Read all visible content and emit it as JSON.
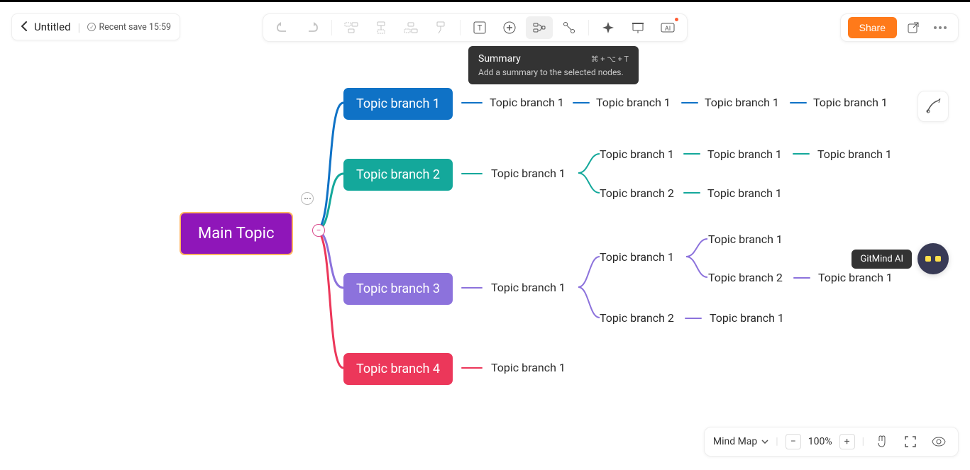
{
  "header": {
    "title": "Untitled",
    "recent_save": "Recent save 15:59"
  },
  "toolbar": {
    "tooltip": {
      "title": "Summary",
      "shortcut": "⌘ + ⌥ + T",
      "desc": "Add a summary to the selected nodes."
    }
  },
  "share_label": "Share",
  "ai_float_label": "GitMind AI",
  "mindmap": {
    "root": "Main Topic",
    "branches": [
      {
        "label": "Topic branch 1",
        "color": "#0f72c6",
        "children": [
          "Topic branch 1",
          "Topic branch 1",
          "Topic branch 1",
          "Topic branch 1"
        ]
      },
      {
        "label": "Topic branch 2",
        "color": "#14a89b",
        "children": [
          {
            "label": "Topic branch 1",
            "children": [
              {
                "label": "Topic branch 1",
                "children": [
                  "Topic branch 1",
                  "Topic branch 1"
                ]
              },
              {
                "label": "Topic branch 2",
                "children": [
                  "Topic branch 1"
                ]
              }
            ]
          }
        ]
      },
      {
        "label": "Topic branch 3",
        "color": "#8c72dc",
        "children": [
          {
            "label": "Topic branch 1",
            "children": [
              {
                "label": "Topic branch 1",
                "children": [
                  "Topic branch 1",
                  {
                    "label": "Topic branch 2",
                    "children": [
                      "Topic branch 1"
                    ]
                  }
                ]
              },
              {
                "label": "Topic branch 2",
                "children": [
                  "Topic branch 1"
                ]
              }
            ]
          }
        ]
      },
      {
        "label": "Topic branch 4",
        "color": "#ec375a",
        "children": [
          "Topic branch 1"
        ]
      }
    ]
  },
  "bottom": {
    "layout": "Mind Map",
    "zoom": "100%"
  },
  "leaf": {
    "tb1": "Topic branch 1",
    "tb2": "Topic branch 2"
  }
}
